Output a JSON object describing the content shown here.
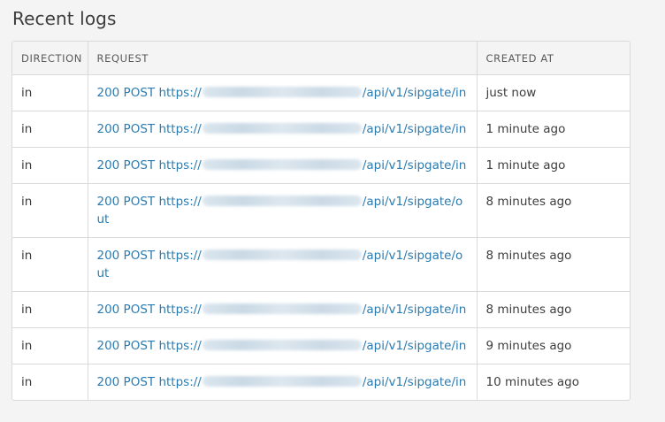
{
  "section": {
    "title": "Recent logs"
  },
  "table": {
    "headers": {
      "direction": "DIRECTION",
      "request": "REQUEST",
      "created_at": "CREATED AT"
    },
    "rows": [
      {
        "direction": "in",
        "status_method": "200 POST",
        "scheme": "https://",
        "path": "/api/v1/sipgate/in",
        "created_at": "just now"
      },
      {
        "direction": "in",
        "status_method": "200 POST",
        "scheme": "https://",
        "path": "/api/v1/sipgate/in",
        "created_at": "1 minute ago"
      },
      {
        "direction": "in",
        "status_method": "200 POST",
        "scheme": "https://",
        "path": "/api/v1/sipgate/in",
        "created_at": "1 minute ago"
      },
      {
        "direction": "in",
        "status_method": "200 POST",
        "scheme": "https://",
        "path": "/api/v1/sipgate/out",
        "created_at": "8 minutes ago"
      },
      {
        "direction": "in",
        "status_method": "200 POST",
        "scheme": "https://",
        "path": "/api/v1/sipgate/out",
        "created_at": "8 minutes ago"
      },
      {
        "direction": "in",
        "status_method": "200 POST",
        "scheme": "https://",
        "path": "/api/v1/sipgate/in",
        "created_at": "8 minutes ago"
      },
      {
        "direction": "in",
        "status_method": "200 POST",
        "scheme": "https://",
        "path": "/api/v1/sipgate/in",
        "created_at": "9 minutes ago"
      },
      {
        "direction": "in",
        "status_method": "200 POST",
        "scheme": "https://",
        "path": "/api/v1/sipgate/in",
        "created_at": "10 minutes ago"
      }
    ]
  },
  "colors": {
    "link": "#2b7bb0",
    "border": "#d8dadc",
    "header_bg": "#f4f4f4",
    "page_bg": "#f4f4f4"
  }
}
